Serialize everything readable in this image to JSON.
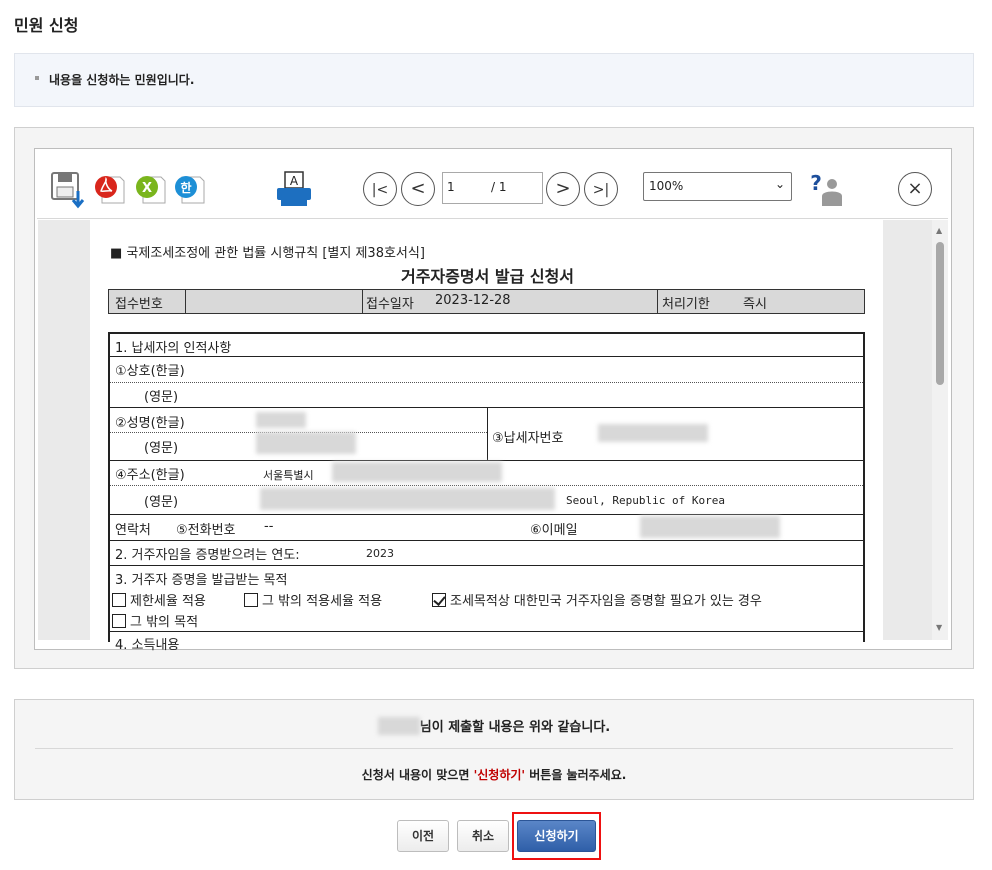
{
  "page": {
    "title": "민원 신청",
    "notice": "내용을 신청하는 민원입니다."
  },
  "viewer": {
    "toolbar": {
      "save_icon": "save-download-icon",
      "pdf_icon": "pdf-icon",
      "excel_icon": "excel-icon",
      "hwp_icon": "hwp-icon",
      "print_icon": "print-icon",
      "first_page": "|<",
      "prev_page": "<",
      "next_page": ">",
      "last_page": ">|",
      "current_page": "1",
      "total_pages": "/ 1",
      "zoom": "100%",
      "help_icon": "help-icon",
      "close_icon": "close-icon",
      "close_glyph": "×"
    },
    "document": {
      "form_reference": "■ 국제조세조정에 관한 법률 시행규칙 [별지 제38호서식]",
      "form_title": "거주자증명서 발급 신청서",
      "receipt_number_label": "접수번호",
      "receipt_date_label": "접수일자",
      "receipt_date_value": "2023-12-28",
      "processing_period_label": "처리기한",
      "processing_period_value": "즉시",
      "section1_title": "1. 납세자의 인적사항",
      "company_korean_label": "①상호(한글)",
      "company_english_label": "(영문)",
      "name_korean_label": "②성명(한글)",
      "name_english_label": "(영문)",
      "taxpayer_number_label": "③납세자번호",
      "address_korean_label": "④주소(한글)",
      "address_korean_value": "서울특별시",
      "address_english_label": "(영문)",
      "address_english_value": "Seoul, Republic of Korea",
      "contact_label": "연락처",
      "phone_label": "⑤전화번호",
      "phone_value": "--",
      "email_label": "⑥이메일",
      "section2_title": "2. 거주자임을 증명받으려는 연도:",
      "section2_year": "2023",
      "section3_title": "3. 거주자 증명을 발급받는 목적",
      "purpose_options": [
        {
          "label": "제한세율 적용",
          "checked": false
        },
        {
          "label": "그 밖의 적용세율 적용",
          "checked": false
        },
        {
          "label": "조세목적상 대한민국 거주자임을 증명할 필요가 있는 경우",
          "checked": true
        },
        {
          "label": "그 밖의 목적",
          "checked": false
        }
      ],
      "section4_partial": "4. 소득내용"
    }
  },
  "confirm": {
    "line1_suffix": "님이 제출할 내용은 위와 같습니다.",
    "line2_prefix": "신청서 내용이 맞으면 ",
    "line2_highlight": "'신청하기'",
    "line2_suffix": " 버튼을 눌러주세요."
  },
  "buttons": {
    "prev": "이전",
    "cancel": "취소",
    "submit": "신청하기"
  },
  "colors": {
    "accent_red": "#c00000",
    "primary_blue": "#2f5fa8",
    "highlight_border": "#ee1111"
  }
}
